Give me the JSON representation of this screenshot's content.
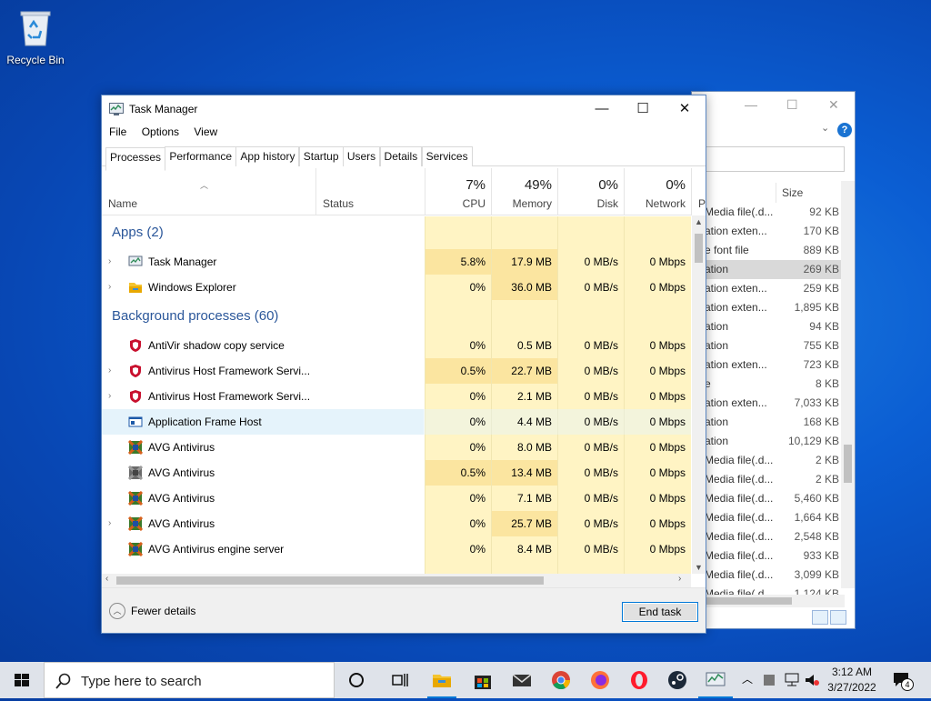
{
  "desktop": {
    "recycle_bin_label": "Recycle Bin"
  },
  "explorer": {
    "size_header": "Size",
    "rows": [
      {
        "name": "Media file(.d...",
        "size": "92 KB"
      },
      {
        "name": "ation exten...",
        "size": "170 KB"
      },
      {
        "name": "e font file",
        "size": "889 KB"
      },
      {
        "name": "ation",
        "size": "269 KB",
        "selected": true
      },
      {
        "name": "ation exten...",
        "size": "259 KB"
      },
      {
        "name": "ation exten...",
        "size": "1,895 KB"
      },
      {
        "name": "ation",
        "size": "94 KB"
      },
      {
        "name": "ation",
        "size": "755 KB"
      },
      {
        "name": "ation exten...",
        "size": "723 KB"
      },
      {
        "name": "e",
        "size": "8 KB"
      },
      {
        "name": "ation exten...",
        "size": "7,033 KB"
      },
      {
        "name": "ation",
        "size": "168 KB"
      },
      {
        "name": "ation",
        "size": "10,129 KB"
      },
      {
        "name": "Media file(.d...",
        "size": "2 KB"
      },
      {
        "name": "Media file(.d...",
        "size": "2 KB"
      },
      {
        "name": "Media file(.d...",
        "size": "5,460 KB"
      },
      {
        "name": "Media file(.d...",
        "size": "1,664 KB"
      },
      {
        "name": "Media file(.d...",
        "size": "2,548 KB"
      },
      {
        "name": "Media file(.d...",
        "size": "933 KB"
      },
      {
        "name": "Media file(.d...",
        "size": "3,099 KB"
      },
      {
        "name": "Media file(.d...",
        "size": "1,124 KB"
      }
    ]
  },
  "taskmanager": {
    "title": "Task Manager",
    "menu": [
      "File",
      "Options",
      "View"
    ],
    "tabs": [
      "Processes",
      "Performance",
      "App history",
      "Startup",
      "Users",
      "Details",
      "Services"
    ],
    "columns": {
      "name": "Name",
      "status": "Status",
      "cpu": {
        "pct": "7%",
        "label": "CPU"
      },
      "memory": {
        "pct": "49%",
        "label": "Memory"
      },
      "disk": {
        "pct": "0%",
        "label": "Disk"
      },
      "network": {
        "pct": "0%",
        "label": "Network"
      },
      "power": "P"
    },
    "groups": {
      "apps": "Apps (2)",
      "background": "Background processes (60)"
    },
    "apps": [
      {
        "name": "Task Manager",
        "cpu": "5.8%",
        "memory": "17.9 MB",
        "disk": "0 MB/s",
        "network": "0 Mbps",
        "expandable": true,
        "icon": "task-manager-icon"
      },
      {
        "name": "Windows Explorer",
        "cpu": "0%",
        "memory": "36.0 MB",
        "disk": "0 MB/s",
        "network": "0 Mbps",
        "expandable": true,
        "icon": "folder-icon"
      }
    ],
    "background": [
      {
        "name": "AntiVir shadow copy service",
        "cpu": "0%",
        "memory": "0.5 MB",
        "disk": "0 MB/s",
        "network": "0 Mbps",
        "expandable": false,
        "icon": "shield-icon",
        "state": "selected"
      },
      {
        "name": "Antivirus Host Framework Servi...",
        "cpu": "0.5%",
        "memory": "22.7 MB",
        "disk": "0 MB/s",
        "network": "0 Mbps",
        "expandable": true,
        "icon": "shield-icon"
      },
      {
        "name": "Antivirus Host Framework Servi...",
        "cpu": "0%",
        "memory": "2.1 MB",
        "disk": "0 MB/s",
        "network": "0 Mbps",
        "expandable": true,
        "icon": "shield-icon"
      },
      {
        "name": "Application Frame Host",
        "cpu": "0%",
        "memory": "4.4 MB",
        "disk": "0 MB/s",
        "network": "0 Mbps",
        "expandable": false,
        "icon": "app-frame-icon",
        "state": "hover"
      },
      {
        "name": "AVG Antivirus",
        "cpu": "0%",
        "memory": "8.0 MB",
        "disk": "0 MB/s",
        "network": "0 Mbps",
        "expandable": false,
        "icon": "avg-icon"
      },
      {
        "name": "AVG Antivirus",
        "cpu": "0.5%",
        "memory": "13.4 MB",
        "disk": "0 MB/s",
        "network": "0 Mbps",
        "expandable": false,
        "icon": "avg-gray-icon"
      },
      {
        "name": "AVG Antivirus",
        "cpu": "0%",
        "memory": "7.1 MB",
        "disk": "0 MB/s",
        "network": "0 Mbps",
        "expandable": false,
        "icon": "avg-icon"
      },
      {
        "name": "AVG Antivirus",
        "cpu": "0%",
        "memory": "25.7 MB",
        "disk": "0 MB/s",
        "network": "0 Mbps",
        "expandable": true,
        "icon": "avg-icon"
      },
      {
        "name": "AVG Antivirus engine server",
        "cpu": "0%",
        "memory": "8.4 MB",
        "disk": "0 MB/s",
        "network": "0 Mbps",
        "expandable": false,
        "icon": "avg-icon"
      }
    ],
    "footer": {
      "fewer_details": "Fewer details",
      "end_task": "End task"
    }
  },
  "taskbar": {
    "search_placeholder": "Type here to search",
    "time": "3:12 AM",
    "date": "3/27/2022",
    "notification_count": "4"
  },
  "colors": {
    "accent": "#0078d7",
    "group_header": "#2b579a",
    "heat_light": "#fff4c4",
    "heat_mid": "#fbe5a0"
  }
}
